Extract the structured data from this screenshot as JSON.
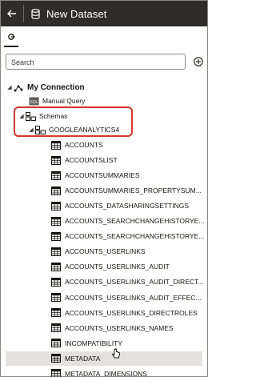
{
  "header": {
    "title": "New Dataset",
    "back_icon": "back-arrow-icon",
    "source_icon": "database-icon"
  },
  "tabs": [
    {
      "icon": "connection-tab-icon",
      "active": true
    }
  ],
  "search": {
    "placeholder": "Search",
    "value": ""
  },
  "add_button": {
    "icon": "add-circle-icon"
  },
  "tree": {
    "connection": "My Connection",
    "manual_query": "Manual Query",
    "schemas": "Schemas",
    "schema": "GOOGLEANALYTICS4",
    "tables": [
      "ACCOUNTS",
      "ACCOUNTSLIST",
      "ACCOUNTSUMMARIES",
      "ACCOUNTSUMMARIES_PROPERTYSUM...",
      "ACCOUNTS_DATASHARINGSETTINGS",
      "ACCOUNTS_SEARCHCHANGEHISTORYE...",
      "ACCOUNTS_SEARCHCHANGEHISTORYE...",
      "ACCOUNTS_USERLINKS",
      "ACCOUNTS_USERLINKS_AUDIT",
      "ACCOUNTS_USERLINKS_AUDIT_DIRECT...",
      "ACCOUNTS_USERLINKS_AUDIT_EFFEC...",
      "ACCOUNTS_USERLINKS_DIRECTROLES",
      "ACCOUNTS_USERLINKS_NAMES",
      "INCOMPATIBILITY",
      "METADATA",
      "METADATA_DIMENSIONS"
    ],
    "highlighted_table": "METADATA"
  },
  "colors": {
    "header_bg": "#2f2d2b",
    "callout": "#d4382c",
    "row_highlight": "#e4e1dd"
  }
}
